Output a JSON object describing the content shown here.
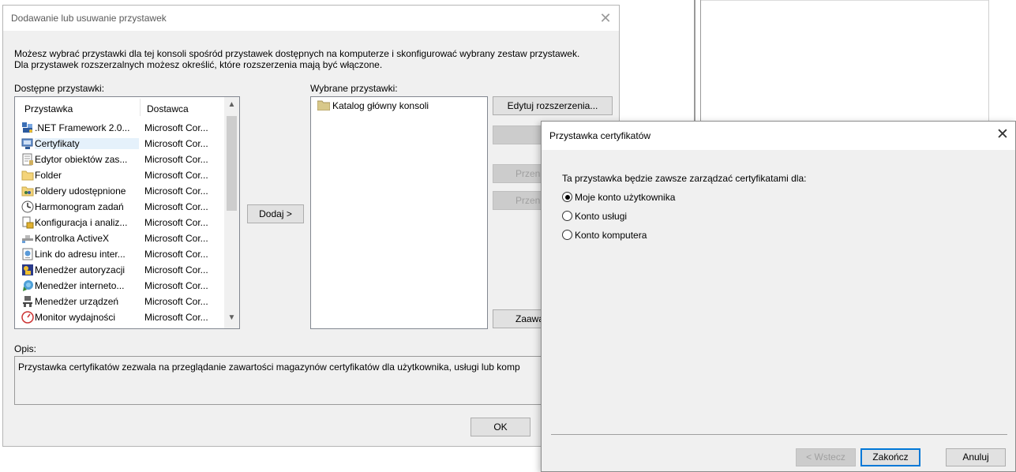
{
  "main_dialog": {
    "title": "Dodawanie lub usuwanie przystawek",
    "intro_line1": "Możesz wybrać przystawki dla tej konsoli spośród przystawek dostępnych na komputerze i skonfigurować wybrany zestaw przystawek.",
    "intro_line2": "Dla przystawek rozszerzalnych możesz określić, które rozszerzenia mają być włączone.",
    "available_label": "Dostępne przystawki:",
    "selected_label": "Wybrane przystawki:",
    "columns": {
      "name": "Przystawka",
      "vendor": "Dostawca"
    },
    "available": [
      {
        "name": ".NET Framework 2.0...",
        "vendor": "Microsoft Cor...",
        "icon": "dotnet-icon"
      },
      {
        "name": "Certyfikaty",
        "vendor": "Microsoft Cor...",
        "icon": "certificates-icon",
        "selected": true
      },
      {
        "name": "Edytor obiektów zas...",
        "vendor": "Microsoft Cor...",
        "icon": "policy-editor-icon"
      },
      {
        "name": "Folder",
        "vendor": "Microsoft Cor...",
        "icon": "folder-icon"
      },
      {
        "name": "Foldery udostępnione",
        "vendor": "Microsoft Cor...",
        "icon": "shared-folders-icon"
      },
      {
        "name": "Harmonogram zadań",
        "vendor": "Microsoft Cor...",
        "icon": "task-scheduler-icon"
      },
      {
        "name": "Konfiguracja i analiz...",
        "vendor": "Microsoft Cor...",
        "icon": "security-config-icon"
      },
      {
        "name": "Kontrolka ActiveX",
        "vendor": "Microsoft Cor...",
        "icon": "activex-icon"
      },
      {
        "name": "Link do adresu inter...",
        "vendor": "Microsoft Cor...",
        "icon": "web-link-icon"
      },
      {
        "name": "Menedżer autoryzacji",
        "vendor": "Microsoft Cor...",
        "icon": "authorization-manager-icon"
      },
      {
        "name": "Menedżer interneto...",
        "vendor": "Microsoft Cor...",
        "icon": "iis-manager-icon"
      },
      {
        "name": "Menedżer urządzeń",
        "vendor": "Microsoft Cor...",
        "icon": "device-manager-icon"
      },
      {
        "name": "Monitor wydajności",
        "vendor": "Microsoft Cor...",
        "icon": "performance-monitor-icon"
      }
    ],
    "selected_items": [
      {
        "name": "Katalog główny konsoli",
        "icon": "folder-icon"
      }
    ],
    "add_button": "Dodaj >",
    "edit_extensions_button": "Edytuj rozszerzenia...",
    "move_up_partial": "Przen",
    "move_down_partial": "Przen",
    "advanced_partial": "Zaawa",
    "description_label": "Opis:",
    "description_text": "Przystawka certyfikatów zezwala na przeglądanie zawartości magazynów certyfikatów dla użytkownika, usługi lub komp",
    "ok_button": "OK"
  },
  "cert_dialog": {
    "title": "Przystawka certyfikatów",
    "prompt": "Ta przystawka będzie zawsze zarządzać certyfikatami dla:",
    "options": [
      {
        "label": "Moje konto użytkownika",
        "checked": true
      },
      {
        "label": "Konto usługi",
        "checked": false
      },
      {
        "label": "Konto komputera",
        "checked": false
      }
    ],
    "back_button": "< Wstecz",
    "finish_button": "Zakończ",
    "cancel_button": "Anuluj"
  }
}
